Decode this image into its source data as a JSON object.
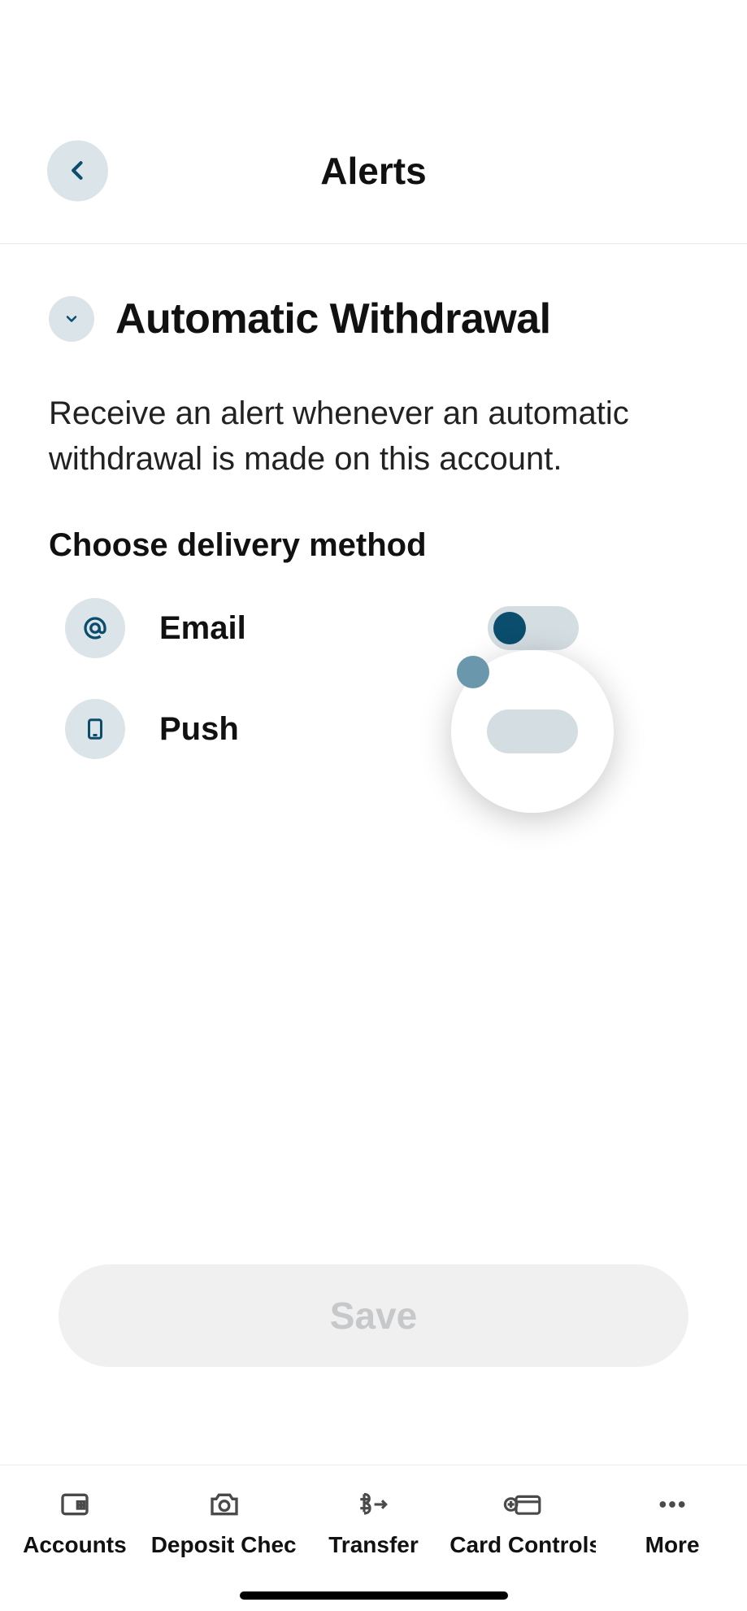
{
  "header": {
    "title": "Alerts"
  },
  "section": {
    "title": "Automatic Withdrawal",
    "description": "Receive an alert whenever an automatic withdrawal is made on this account.",
    "delivery_label": "Choose delivery method",
    "options": {
      "email": {
        "label": "Email",
        "enabled": true
      },
      "push": {
        "label": "Push",
        "enabled": false
      }
    }
  },
  "actions": {
    "save": "Save"
  },
  "tabs": {
    "accounts": "Accounts",
    "deposit": "Deposit Check",
    "transfer": "Transfer",
    "card": "Card Controls",
    "more": "More"
  }
}
